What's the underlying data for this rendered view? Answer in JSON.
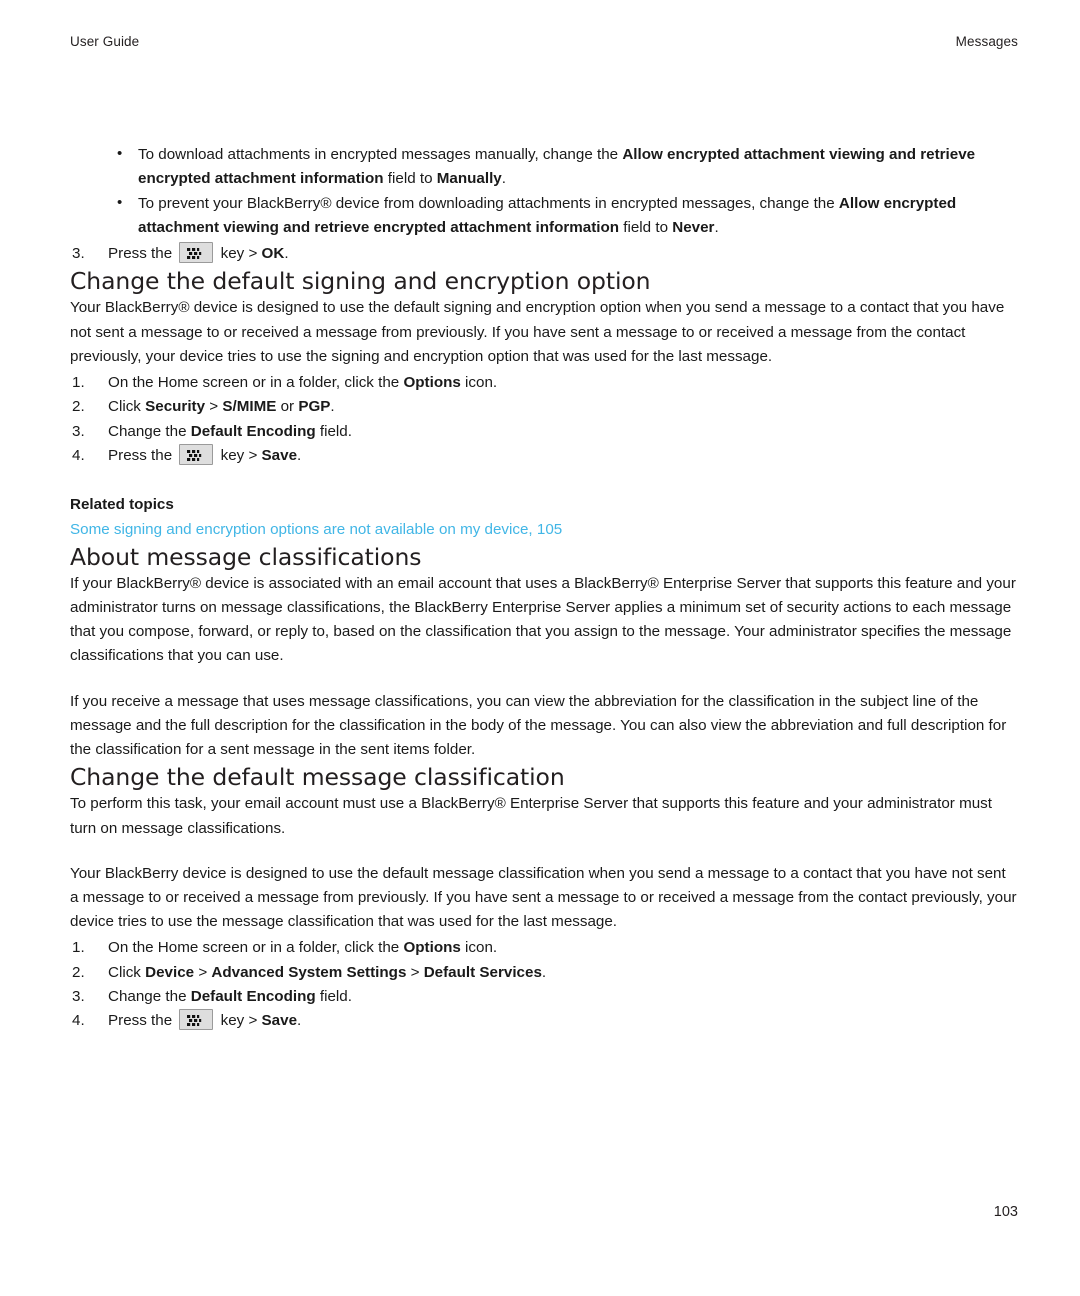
{
  "header": {
    "left": "User Guide",
    "right": "Messages"
  },
  "top_section": {
    "bullets": [
      {
        "segments": [
          {
            "text": "To download attachments in encrypted messages manually, change the ",
            "bold": false
          },
          {
            "text": "Allow encrypted attachment viewing and retrieve encrypted attachment information",
            "bold": true
          },
          {
            "text": " field to ",
            "bold": false
          },
          {
            "text": "Manually",
            "bold": true
          },
          {
            "text": ".",
            "bold": false
          }
        ]
      },
      {
        "segments": [
          {
            "text": "To prevent your BlackBerry® device from downloading attachments in encrypted messages, change the ",
            "bold": false
          },
          {
            "text": "Allow encrypted attachment viewing and retrieve encrypted attachment information",
            "bold": true
          },
          {
            "text": " field to ",
            "bold": false
          },
          {
            "text": "Never",
            "bold": true
          },
          {
            "text": ".",
            "bold": false
          }
        ]
      }
    ],
    "step": {
      "number": "3.",
      "segments": [
        {
          "text": "Press the ",
          "bold": false
        },
        {
          "text": "__KEY__",
          "bold": false
        },
        {
          "text": " key > ",
          "bold": false
        },
        {
          "text": "OK",
          "bold": true
        },
        {
          "text": ".",
          "bold": false
        }
      ]
    }
  },
  "sections": [
    {
      "heading": "Change the default signing and encryption option",
      "paragraphs": [
        {
          "segments": [
            {
              "text": "Your BlackBerry® device is designed to use the default signing and encryption option when you send a message to a contact that you have not sent a message to or received a message from previously. If you have sent a message to or received a message from the contact previously, your device tries to use the signing and encryption option that was used for the last message.",
              "bold": false
            }
          ]
        }
      ],
      "steps": [
        {
          "number": "1.",
          "segments": [
            {
              "text": "On the Home screen or in a folder, click the ",
              "bold": false
            },
            {
              "text": "Options",
              "bold": true
            },
            {
              "text": " icon.",
              "bold": false
            }
          ]
        },
        {
          "number": "2.",
          "segments": [
            {
              "text": "Click ",
              "bold": false
            },
            {
              "text": "Security",
              "bold": true
            },
            {
              "text": " > ",
              "bold": false
            },
            {
              "text": "S/MIME",
              "bold": true
            },
            {
              "text": " or ",
              "bold": false
            },
            {
              "text": "PGP",
              "bold": true
            },
            {
              "text": ".",
              "bold": false
            }
          ]
        },
        {
          "number": "3.",
          "segments": [
            {
              "text": "Change the ",
              "bold": false
            },
            {
              "text": "Default Encoding",
              "bold": true
            },
            {
              "text": " field.",
              "bold": false
            }
          ]
        },
        {
          "number": "4.",
          "segments": [
            {
              "text": "Press the ",
              "bold": false
            },
            {
              "text": "__KEY__",
              "bold": false
            },
            {
              "text": " key > ",
              "bold": false
            },
            {
              "text": "Save",
              "bold": true
            },
            {
              "text": ".",
              "bold": false
            }
          ]
        }
      ],
      "related": {
        "label": "Related topics",
        "link": "Some signing and encryption options are not available on my device, 105"
      }
    },
    {
      "heading": "About message classifications",
      "paragraphs": [
        {
          "segments": [
            {
              "text": "If your BlackBerry® device is associated with an email account that uses a BlackBerry® Enterprise Server that supports this feature and your administrator turns on message classifications, the BlackBerry Enterprise Server applies a minimum set of security actions to each message that you compose, forward, or reply to, based on the classification that you assign to the message. Your administrator specifies the message classifications that you can use.",
              "bold": false
            }
          ]
        },
        {
          "segments": [
            {
              "text": "If you receive a message that uses message classifications, you can view the abbreviation for the classification in the subject line of the message and the full description for the classification in the body of the message. You can also view the abbreviation and full description for the classification for a sent message in the sent items folder.",
              "bold": false
            }
          ]
        }
      ],
      "steps": [],
      "related": null
    },
    {
      "heading": "Change the default message classification",
      "paragraphs": [
        {
          "segments": [
            {
              "text": "To perform this task, your email account must use a BlackBerry® Enterprise Server that supports this feature and your administrator must turn on message classifications.",
              "bold": false
            }
          ]
        },
        {
          "segments": [
            {
              "text": "Your BlackBerry device is designed to use the default message classification when you send a message to a contact that you have not sent a message to or received a message from previously. If you have sent a message to or received a message from the contact previously, your device tries to use the message classification that was used for the last message.",
              "bold": false
            }
          ]
        }
      ],
      "steps": [
        {
          "number": "1.",
          "segments": [
            {
              "text": "On the Home screen or in a folder, click the ",
              "bold": false
            },
            {
              "text": "Options",
              "bold": true
            },
            {
              "text": " icon.",
              "bold": false
            }
          ]
        },
        {
          "number": "2.",
          "segments": [
            {
              "text": "Click ",
              "bold": false
            },
            {
              "text": "Device",
              "bold": true
            },
            {
              "text": " > ",
              "bold": false
            },
            {
              "text": "Advanced System Settings",
              "bold": true
            },
            {
              "text": " > ",
              "bold": false
            },
            {
              "text": "Default Services",
              "bold": true
            },
            {
              "text": ".",
              "bold": false
            }
          ]
        },
        {
          "number": "3.",
          "segments": [
            {
              "text": "Change the ",
              "bold": false
            },
            {
              "text": "Default Encoding",
              "bold": true
            },
            {
              "text": " field.",
              "bold": false
            }
          ]
        },
        {
          "number": "4.",
          "segments": [
            {
              "text": "Press the ",
              "bold": false
            },
            {
              "text": "__KEY__",
              "bold": false
            },
            {
              "text": " key > ",
              "bold": false
            },
            {
              "text": "Save",
              "bold": true
            },
            {
              "text": ".",
              "bold": false
            }
          ]
        }
      ],
      "related": null
    }
  ],
  "bullet_glyph": "•",
  "menu_key_icon": "blackberry-menu-key-icon",
  "folio": "103",
  "colors": {
    "link": "#41b6e6",
    "text": "#1a1a1a",
    "key_fill": "#dedede",
    "key_border": "#9a9a9a"
  }
}
